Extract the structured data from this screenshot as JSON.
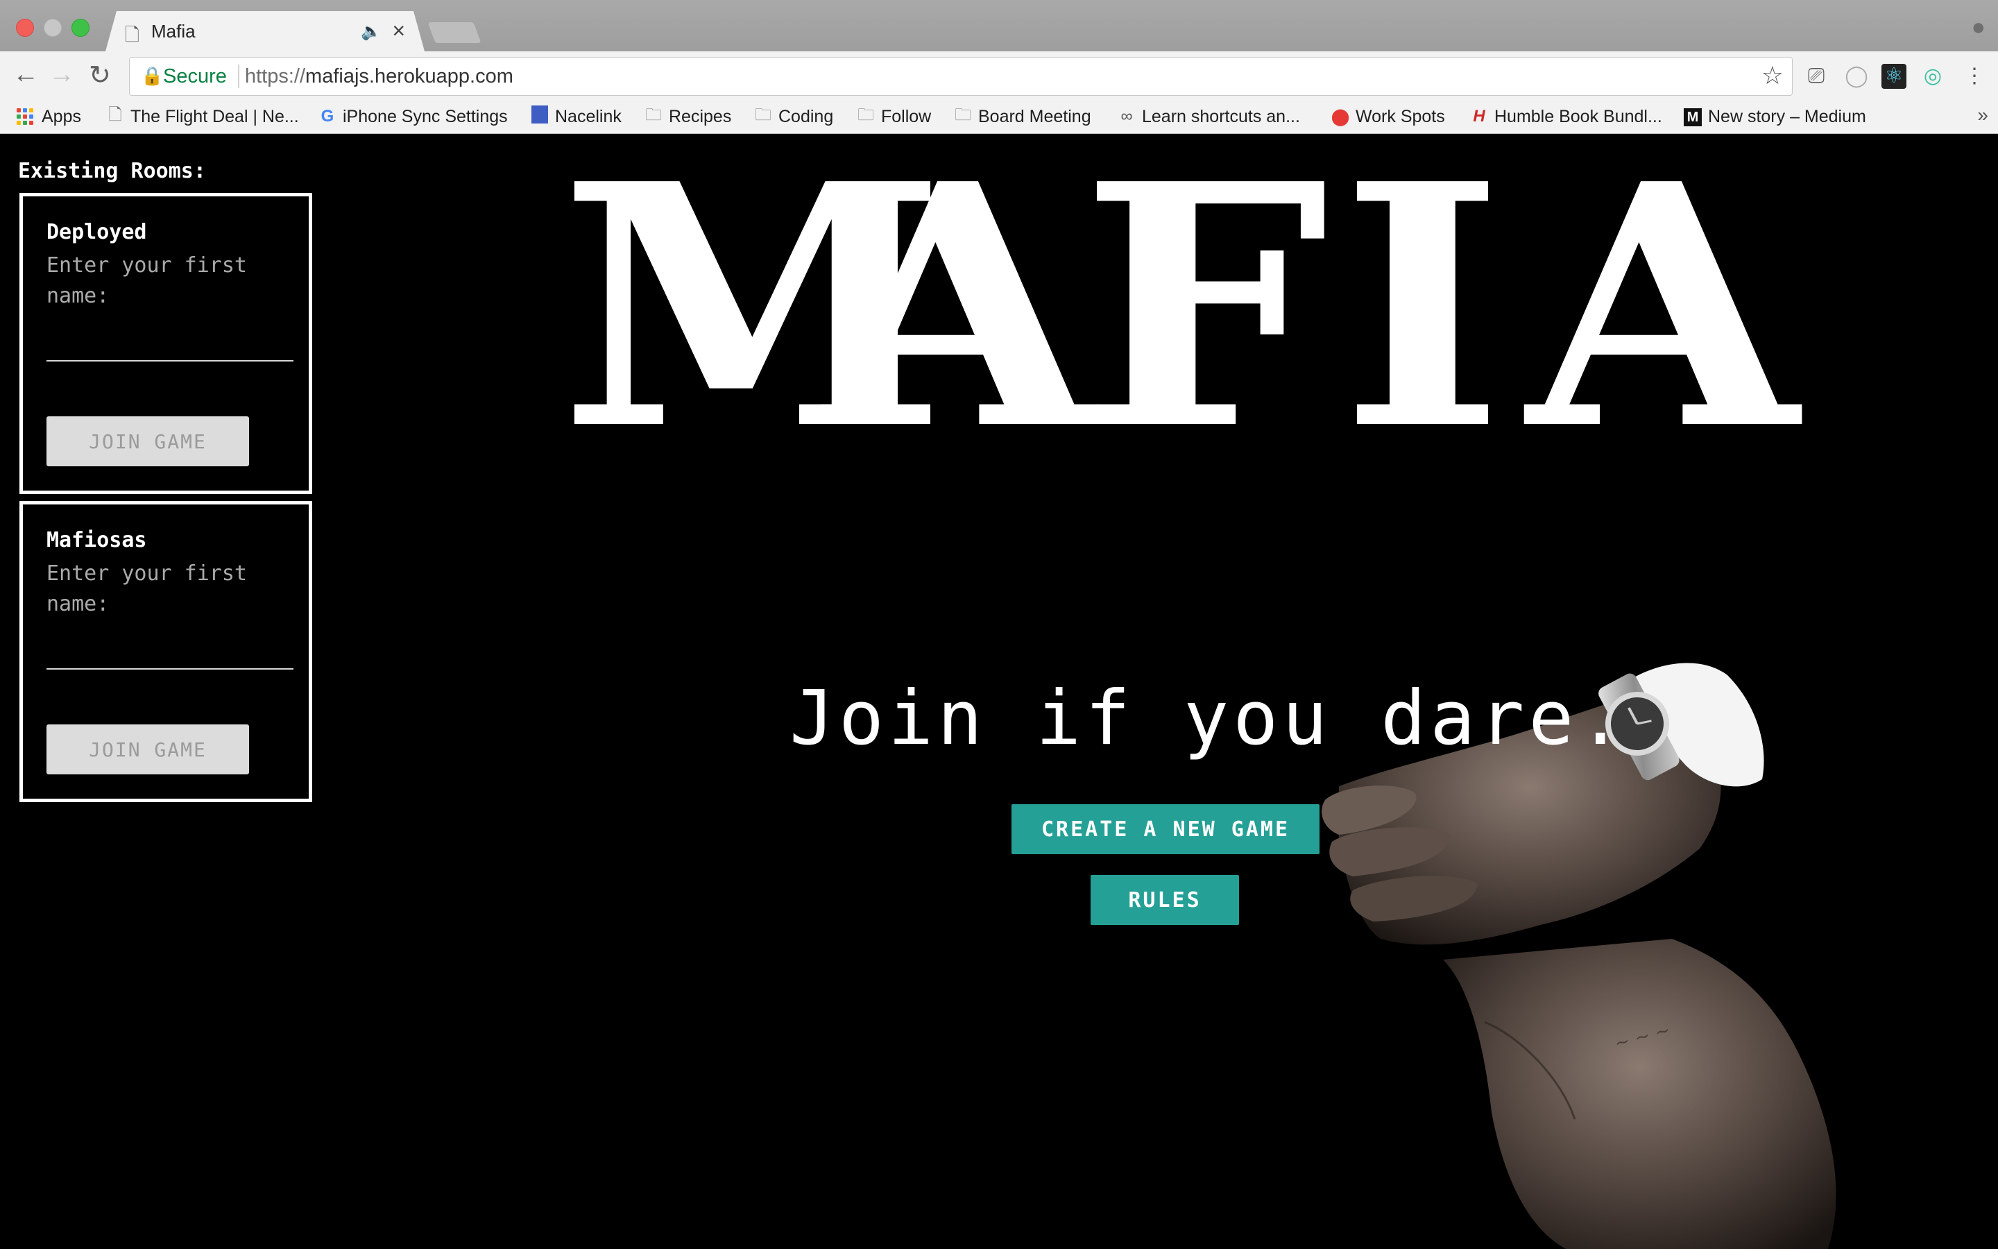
{
  "browser": {
    "tab_title": "Mafia",
    "omnibox": {
      "secure_label": "Secure",
      "url_scheme": "https://",
      "url_host": "mafiajs.herokuapp.com"
    },
    "bookmarks": [
      {
        "label": "Apps",
        "icon": "apps-grid-icon"
      },
      {
        "label": "The Flight Deal | Ne...",
        "icon": "document-icon"
      },
      {
        "label": "iPhone Sync Settings",
        "icon": "google-icon"
      },
      {
        "label": "Nacelink",
        "icon": "nacelink-icon"
      },
      {
        "label": "Recipes",
        "icon": "folder-icon"
      },
      {
        "label": "Coding",
        "icon": "folder-icon"
      },
      {
        "label": "Follow",
        "icon": "folder-icon"
      },
      {
        "label": "Board Meeting",
        "icon": "folder-icon"
      },
      {
        "label": "Learn shortcuts an...",
        "icon": "shortcuts-icon"
      },
      {
        "label": "Work Spots",
        "icon": "map-pin-icon"
      },
      {
        "label": "Humble Book Bundl...",
        "icon": "humble-icon"
      },
      {
        "label": "New story – Medium",
        "icon": "medium-icon"
      }
    ],
    "more_bookmarks": "»"
  },
  "sidebar": {
    "heading": "Existing Rooms:",
    "rooms": [
      {
        "name": "Deployed",
        "prompt": "Enter your first name:",
        "input_value": "",
        "button": "JOIN GAME"
      },
      {
        "name": "Mafiosas",
        "prompt": "Enter your first name:",
        "input_value": "",
        "button": "JOIN GAME"
      }
    ]
  },
  "hero": {
    "logo_letters": [
      "M",
      "A",
      "F",
      "I",
      "A"
    ],
    "tagline": "Join if you dare.",
    "create_button": "CREATE A NEW GAME",
    "rules_button": "RULES"
  },
  "colors": {
    "page_background": "#000000",
    "accent_teal": "#25a096",
    "secure_green": "#0b8043"
  }
}
